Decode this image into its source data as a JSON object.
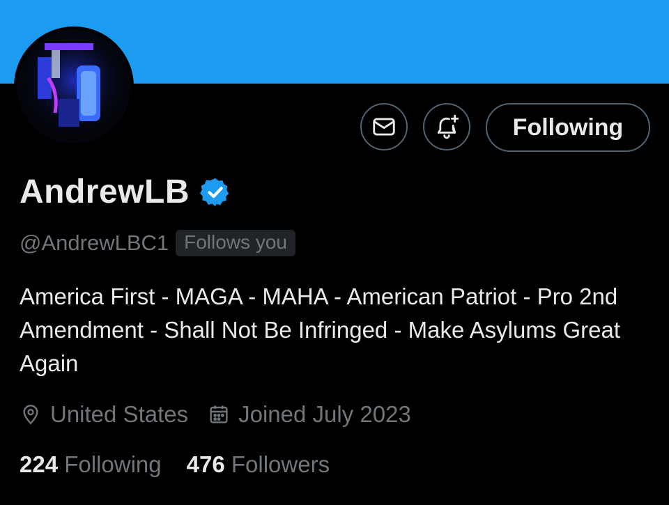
{
  "profile": {
    "display_name": "AndrewLB",
    "handle": "@AndrewLBC1",
    "follows_you_badge": "Follows you",
    "bio": "America First - MAGA - MAHA - American Patriot - Pro 2nd Amendment - Shall Not Be Infringed - Make Asylums Great Again",
    "location": "United States",
    "joined": "Joined July 2023",
    "following_count": "224",
    "following_label": "Following",
    "followers_count": "476",
    "followers_label": "Followers"
  },
  "actions": {
    "follow_state_label": "Following",
    "message_icon": "envelope-icon",
    "notify_icon": "bell-plus-icon"
  },
  "colors": {
    "banner": "#1d9bf0",
    "background": "#000000",
    "primary_text": "#e7e9ea",
    "secondary_text": "#71767b",
    "verified_badge": "#1d9bf0",
    "button_border": "#536471"
  }
}
